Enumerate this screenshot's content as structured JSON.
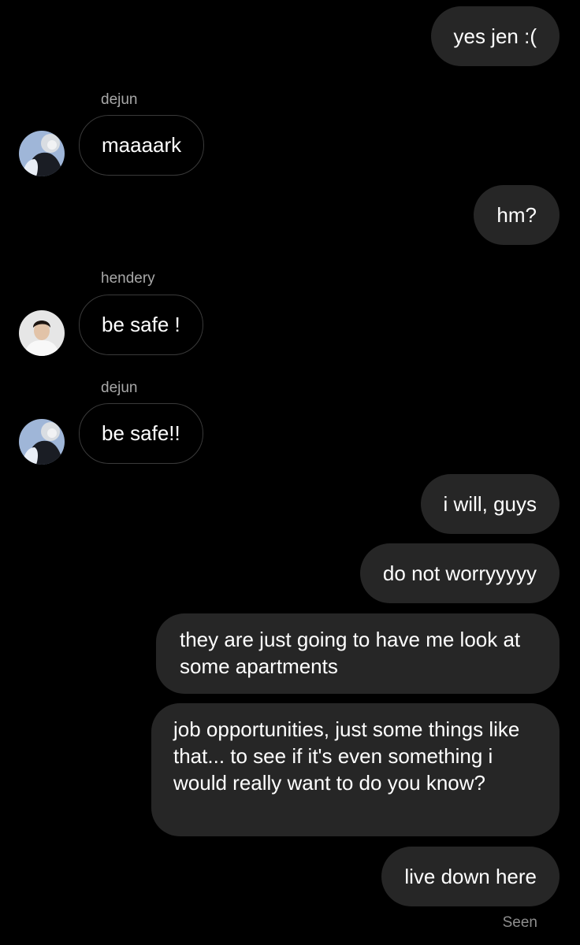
{
  "colors": {
    "background": "#000000",
    "outgoing_bubble": "#262626",
    "incoming_border": "#3a3a3a",
    "text": "#ffffff",
    "secondary_text": "#a8a8a8"
  },
  "messages": {
    "m1": {
      "direction": "outgoing",
      "text": "yes jen :("
    },
    "m2": {
      "direction": "incoming",
      "sender": "dejun",
      "avatar": "dejun-avatar",
      "text": "maaaark"
    },
    "m3": {
      "direction": "outgoing",
      "text": "hm?"
    },
    "m4": {
      "direction": "incoming",
      "sender": "hendery",
      "avatar": "hendery-avatar",
      "text": "be safe !"
    },
    "m5": {
      "direction": "incoming",
      "sender": "dejun",
      "avatar": "dejun-avatar",
      "text": "be safe!!"
    },
    "m6": {
      "direction": "outgoing",
      "text": "i will, guys"
    },
    "m7": {
      "direction": "outgoing",
      "text": "do not worryyyyy"
    },
    "m8": {
      "direction": "outgoing",
      "text": "they are just going to have me look at some apartments"
    },
    "m9": {
      "direction": "outgoing",
      "text": "job opportunities, just some things like that... to see if it's even something i would really want to do you know?"
    },
    "m10": {
      "direction": "outgoing",
      "text": "live down here"
    }
  },
  "status": {
    "seen_label": "Seen"
  }
}
